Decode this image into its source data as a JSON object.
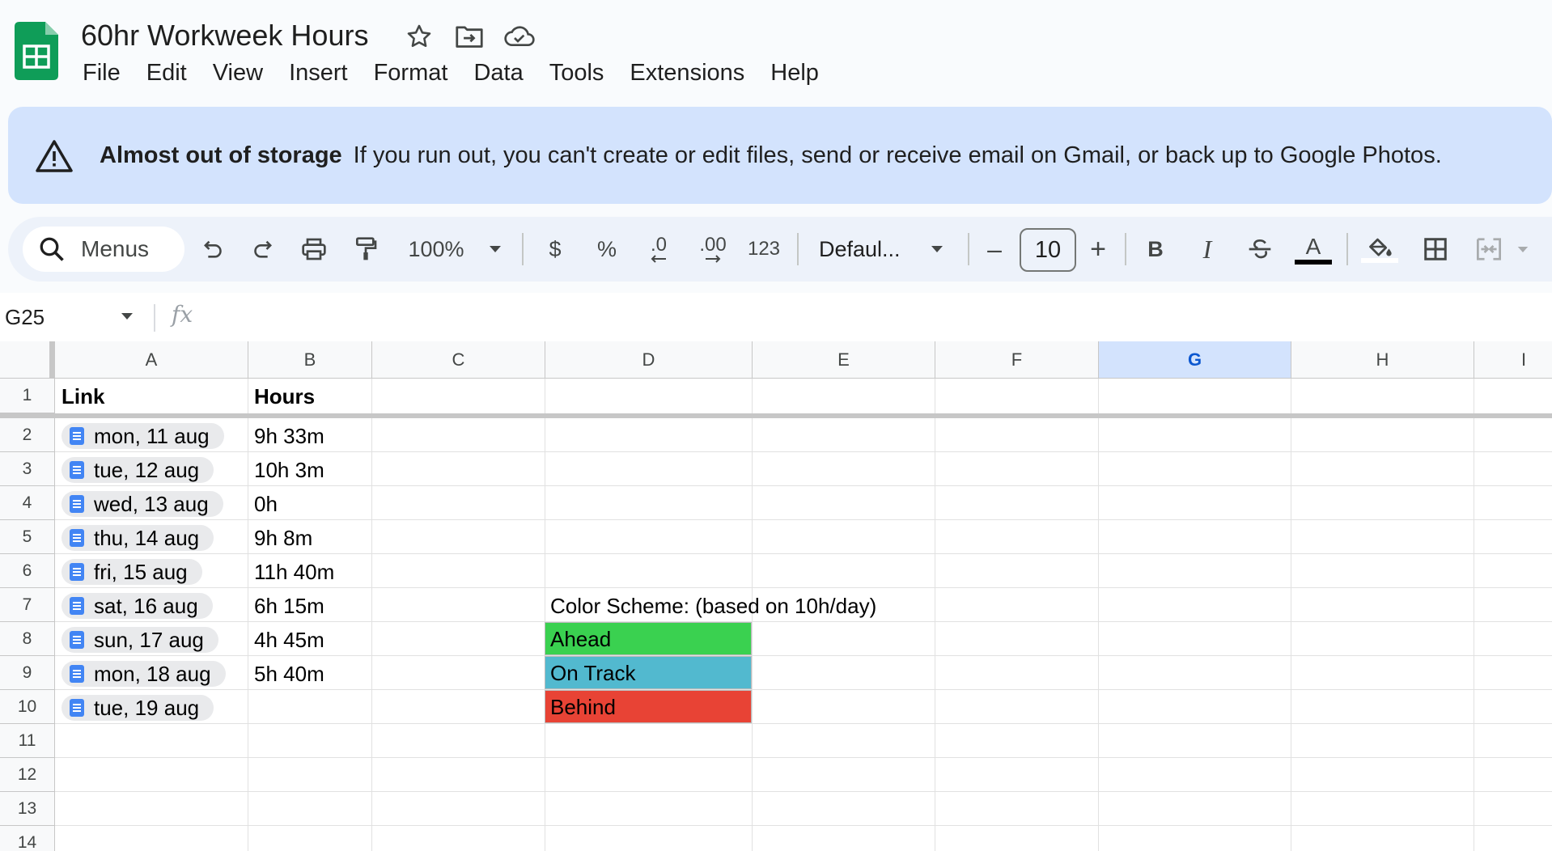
{
  "app": {
    "title": "60hr Workweek Hours",
    "brand_color": "#0f9d58",
    "icons": [
      "star-icon",
      "move-to-folder-icon",
      "cloud-saved-icon"
    ]
  },
  "menu": [
    "File",
    "Edit",
    "View",
    "Insert",
    "Format",
    "Data",
    "Tools",
    "Extensions",
    "Help"
  ],
  "banner": {
    "title": "Almost out of storage",
    "message": "If you run out, you can't create or edit files, send or receive email on Gmail, or back up to Google Photos.",
    "icon": "warning-icon",
    "background": "#d3e3fd"
  },
  "toolbar": {
    "search_label": "Menus",
    "zoom": "100%",
    "currency": "$",
    "percent": "%",
    "decrease_decimal": ".0",
    "increase_decimal": ".00",
    "number_format": "123",
    "font": "Defaul...",
    "font_size": "10",
    "minus": "–",
    "plus": "+",
    "bold": "B",
    "italic": "I",
    "text_color_letter": "A",
    "icons": [
      "undo-icon",
      "redo-icon",
      "print-icon",
      "paint-format-icon",
      "strikethrough-icon",
      "fill-color-icon",
      "borders-icon",
      "merge-cells-icon"
    ]
  },
  "formula_bar": {
    "name_box": "G25",
    "fx": "fx",
    "value": ""
  },
  "grid": {
    "columns": [
      "A",
      "B",
      "C",
      "D",
      "E",
      "F",
      "G",
      "H",
      "I"
    ],
    "selected_column": "G",
    "rows": [
      "1",
      "2",
      "3",
      "4",
      "5",
      "6",
      "7",
      "8",
      "9",
      "10",
      "11",
      "12",
      "13",
      "14"
    ],
    "header_row": {
      "a": "Link",
      "b": "Hours"
    },
    "entries": [
      {
        "link": "mon, 11 aug",
        "hours": "9h 33m"
      },
      {
        "link": "tue, 12 aug",
        "hours": "10h 3m"
      },
      {
        "link": "wed, 13 aug",
        "hours": "0h"
      },
      {
        "link": "thu, 14 aug",
        "hours": "9h 8m"
      },
      {
        "link": "fri, 15 aug",
        "hours": "11h 40m"
      },
      {
        "link": "sat, 16 aug",
        "hours": "6h 15m"
      },
      {
        "link": "sun, 17 aug",
        "hours": "4h 45m"
      },
      {
        "link": "mon, 18 aug",
        "hours": "5h 40m"
      },
      {
        "link": "tue, 19 aug",
        "hours": ""
      }
    ],
    "legend": {
      "title": "Color Scheme: (based on 10h/day)",
      "items": [
        {
          "label": "Ahead",
          "color": "#3ad150"
        },
        {
          "label": "On Track",
          "color": "#52b9cf"
        },
        {
          "label": "Behind",
          "color": "#e84335"
        }
      ]
    }
  }
}
